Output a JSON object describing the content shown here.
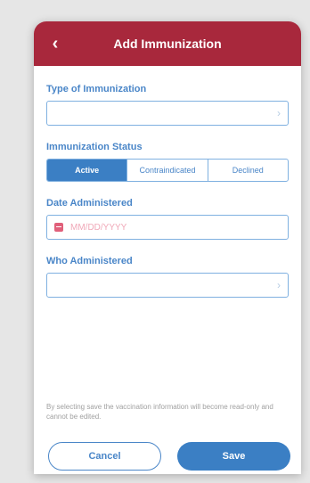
{
  "header": {
    "title": "Add Immunization",
    "back_icon": "‹"
  },
  "form": {
    "type_label": "Type of Immunization",
    "type_value": "",
    "status_label": "Immunization Status",
    "status_options": [
      "Active",
      "Contraindicated",
      "Declined"
    ],
    "status_selected": "Active",
    "date_label": "Date Administered",
    "date_placeholder": "MM/DD/YYYY",
    "who_label": "Who Administered",
    "who_value": ""
  },
  "notice": "By selecting save the vaccination information will become read-only and cannot be edited.",
  "buttons": {
    "cancel": "Cancel",
    "save": "Save"
  },
  "colors": {
    "header": "#a8283c",
    "accent": "#3b7fc4",
    "calendar_icon": "#e0607a"
  }
}
